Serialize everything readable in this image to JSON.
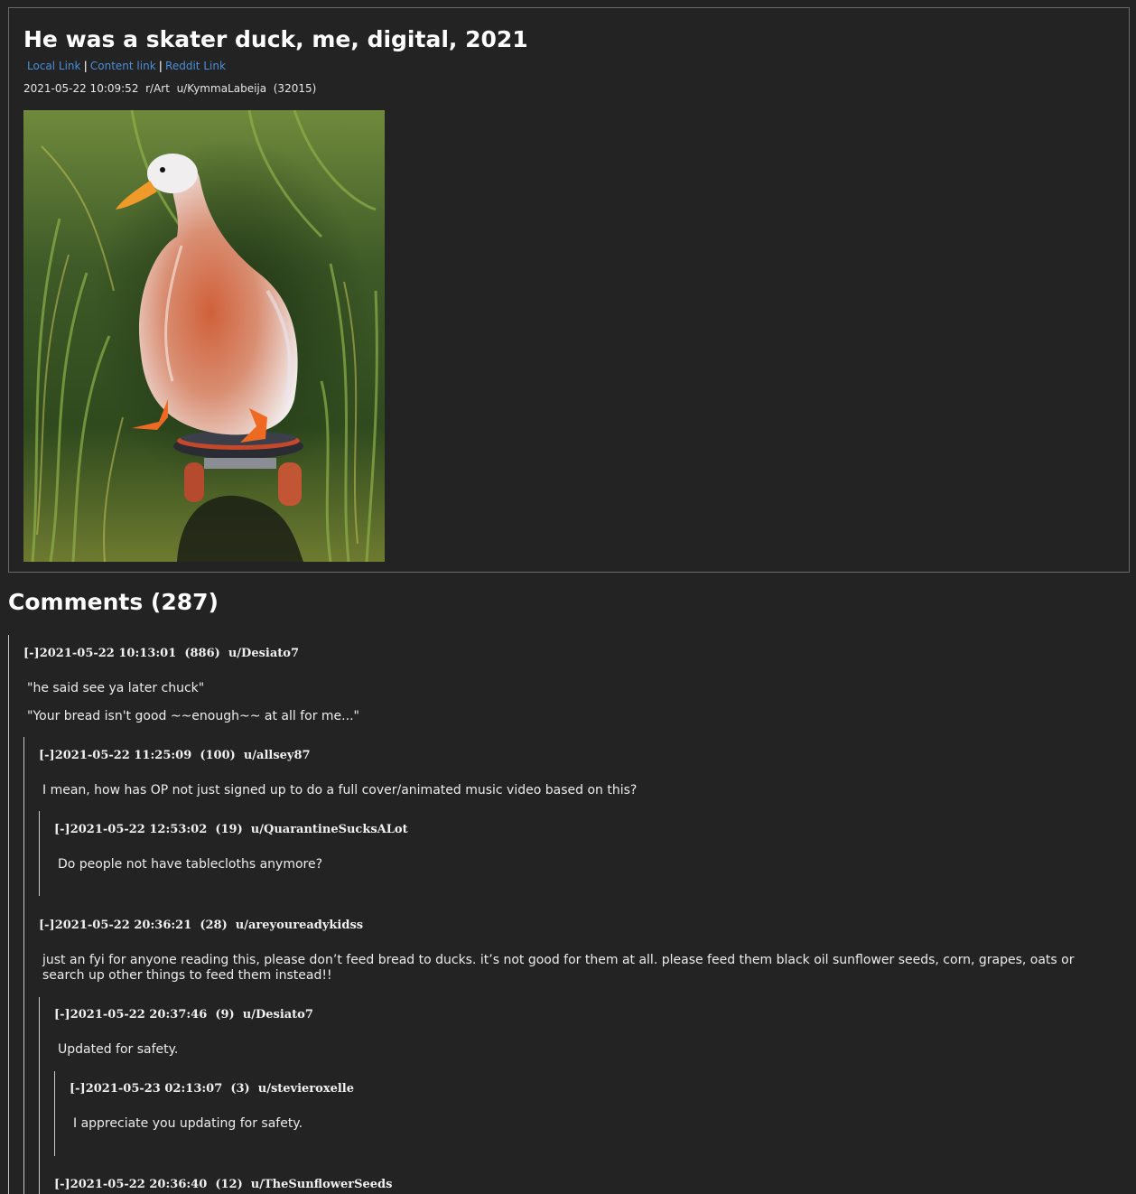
{
  "post": {
    "title": "He was a skater duck, me, digital, 2021",
    "links": {
      "local": "Local Link",
      "content": "Content link",
      "reddit": "Reddit Link",
      "separator": "|"
    },
    "date": "2021-05-22 10:09:52",
    "subreddit": "r/Art",
    "author": "u/KymmaLabeija",
    "score": "(32015)",
    "image_alt": "Painting of a white duck riding a skateboard through tall green grass"
  },
  "comments_heading": "Comments (287)",
  "comments": [
    {
      "toggle": "[-]",
      "date": "2021-05-22 10:13:01",
      "score": "(886)",
      "author": "u/Desiato7",
      "lines": [
        "\"he said see ya later chuck\"",
        "\"Your bread isn't good ~~enough~~ at all for me...\""
      ]
    },
    {
      "toggle": "[-]",
      "date": "2021-05-22 11:25:09",
      "score": "(100)",
      "author": "u/allsey87",
      "lines": [
        "I mean, how has OP not just signed up to do a full cover/animated music video based on this?"
      ]
    },
    {
      "toggle": "[-]",
      "date": "2021-05-22 12:53:02",
      "score": "(19)",
      "author": "u/QuarantineSucksALot",
      "lines": [
        "Do people not have tablecloths anymore?"
      ]
    },
    {
      "toggle": "[-]",
      "date": "2021-05-22 20:36:21",
      "score": "(28)",
      "author": "u/areyoureadykidss",
      "lines": [
        "just an fyi for anyone reading this, please don’t feed bread to ducks. it’s not good for them at all. please feed them black oil sunflower seeds, corn, grapes, oats or search up other things to feed them instead!!"
      ]
    },
    {
      "toggle": "[-]",
      "date": "2021-05-22 20:37:46",
      "score": "(9)",
      "author": "u/Desiato7",
      "lines": [
        "Updated for safety."
      ]
    },
    {
      "toggle": "[-]",
      "date": "2021-05-23 02:13:07",
      "score": "(3)",
      "author": "u/stevieroxelle",
      "lines": [
        "I appreciate you updating for safety."
      ]
    },
    {
      "toggle": "[-]",
      "date": "2021-05-22 20:36:40",
      "score": "(12)",
      "author": "u/TheSunflowerSeeds",
      "lines": []
    }
  ]
}
